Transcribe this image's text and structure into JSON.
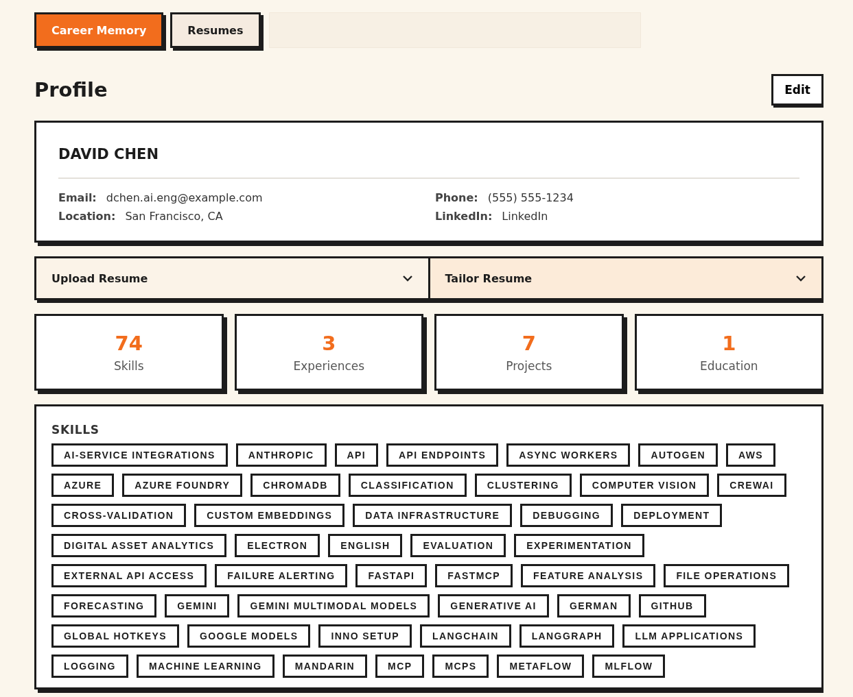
{
  "tabs": [
    {
      "label": "Career Memory",
      "selected": true
    },
    {
      "label": "Resumes",
      "selected": false
    }
  ],
  "header": {
    "title": "Profile",
    "edit_button": "Edit"
  },
  "profile": {
    "name": "DAVID CHEN",
    "fields": [
      {
        "label": "Email:",
        "value": "dchen.ai.eng@example.com"
      },
      {
        "label": "Phone:",
        "value": "(555) 555-1234"
      },
      {
        "label": "Location:",
        "value": "San Francisco, CA"
      },
      {
        "label": "LinkedIn:",
        "value": "LinkedIn"
      }
    ]
  },
  "accordions": [
    {
      "label": "Upload Resume",
      "expanded": false,
      "highlighted": false
    },
    {
      "label": "Tailor Resume",
      "expanded": false,
      "highlighted": true
    }
  ],
  "stats": [
    {
      "value": "74",
      "label": "Skills"
    },
    {
      "value": "3",
      "label": "Experiences"
    },
    {
      "value": "7",
      "label": "Projects"
    },
    {
      "value": "1",
      "label": "Education"
    }
  ],
  "skills": {
    "title": "SKILLS",
    "tags": [
      "AI-SERVICE INTEGRATIONS",
      "ANTHROPIC",
      "API",
      "API ENDPOINTS",
      "ASYNC WORKERS",
      "AUTOGEN",
      "AWS",
      "AZURE",
      "AZURE FOUNDRY",
      "CHROMADB",
      "CLASSIFICATION",
      "CLUSTERING",
      "COMPUTER VISION",
      "CREWAI",
      "CROSS-VALIDATION",
      "CUSTOM EMBEDDINGS",
      "DATA INFRASTRUCTURE",
      "DEBUGGING",
      "DEPLOYMENT",
      "DIGITAL ASSET ANALYTICS",
      "ELECTRON",
      "ENGLISH",
      "EVALUATION",
      "EXPERIMENTATION",
      "EXTERNAL API ACCESS",
      "FAILURE ALERTING",
      "FASTAPI",
      "FASTMCP",
      "FEATURE ANALYSIS",
      "FILE OPERATIONS",
      "FORECASTING",
      "GEMINI",
      "GEMINI MULTIMODAL MODELS",
      "GENERATIVE AI",
      "GERMAN",
      "GITHUB",
      "GLOBAL HOTKEYS",
      "GOOGLE MODELS",
      "INNO SETUP",
      "LANGCHAIN",
      "LANGGRAPH",
      "LLM APPLICATIONS",
      "LOGGING",
      "MACHINE LEARNING",
      "MANDARIN",
      "MCP",
      "MCPS",
      "METAFLOW",
      "MLFLOW"
    ]
  }
}
